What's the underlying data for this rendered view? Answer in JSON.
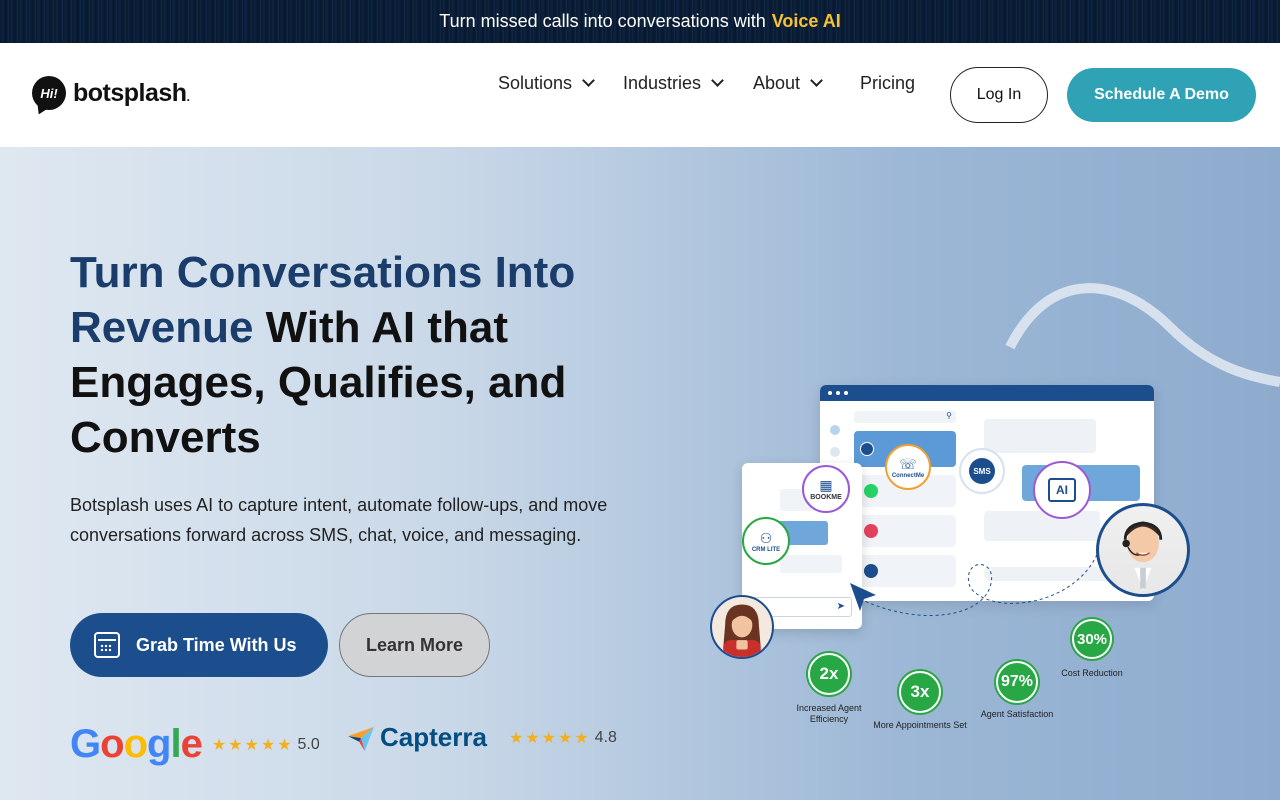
{
  "announcement": {
    "text": "Turn missed calls into conversations with",
    "highlight": "Voice AI"
  },
  "brand": {
    "mark": "Hi!",
    "name": "botsplash",
    "suffix": "."
  },
  "nav": {
    "items": [
      {
        "label": "Solutions",
        "dropdown": true
      },
      {
        "label": "Industries",
        "dropdown": true
      },
      {
        "label": "About",
        "dropdown": true
      },
      {
        "label": "Pricing",
        "dropdown": false
      }
    ],
    "login": "Log In",
    "demo": "Schedule A Demo"
  },
  "hero": {
    "headline_blue": "Turn Conversations Into Revenue",
    "headline_rest": " With AI that Engages, Qualifies, and Converts",
    "subtext": "Botsplash uses AI to capture intent, automate follow-ups, and move conversations forward across SMS, chat, voice, and messaging.",
    "primary_cta": "Grab Time With Us",
    "secondary_cta": "Learn More"
  },
  "reviews": {
    "google": {
      "name": "Google",
      "rating": "5.0",
      "stars": 5
    },
    "capterra": {
      "name": "Capterra",
      "rating": "4.8",
      "stars": 4.8
    }
  },
  "illustration": {
    "badges": {
      "bookme": "BOOKME",
      "connectme": "ConnectMe",
      "sms": "SMS",
      "ai": "AI",
      "crm": "CRM LITE"
    },
    "stats": [
      {
        "value": "2x",
        "label": "Increased Agent Efficiency"
      },
      {
        "value": "3x",
        "label": "More Appointments Set"
      },
      {
        "value": "97%",
        "label": "Agent Satisfaction"
      },
      {
        "value": "30%",
        "label": "Cost Reduction"
      }
    ]
  },
  "colors": {
    "accent_teal": "#2fa3b5",
    "primary_navy": "#1c4e8e",
    "highlight_yellow": "#f7c331",
    "stat_green": "#28a745"
  }
}
